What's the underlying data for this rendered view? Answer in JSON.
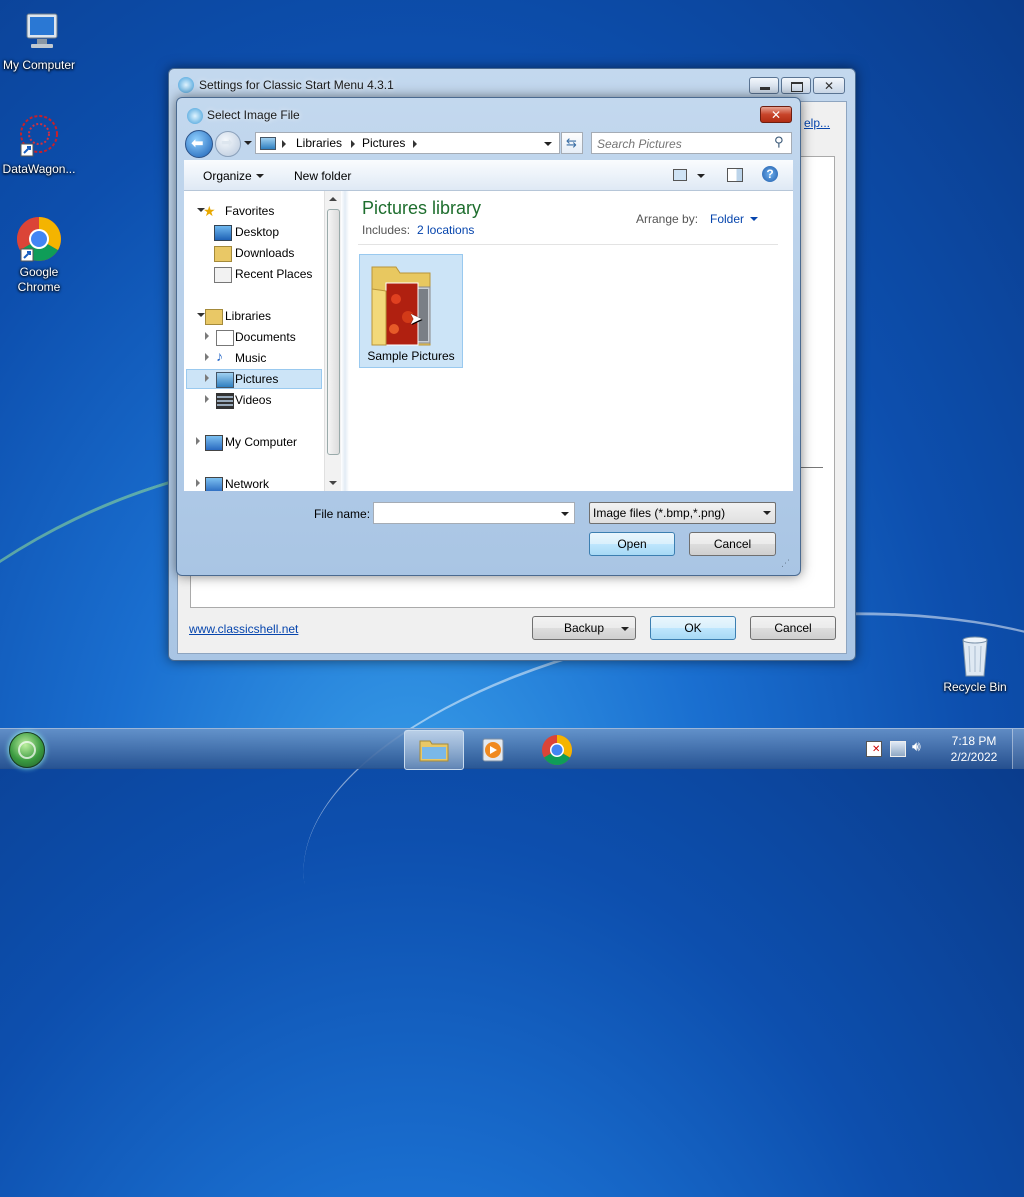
{
  "desktop": {
    "icons": [
      {
        "label": "My Computer"
      },
      {
        "label": "DataWagon..."
      },
      {
        "label_line1": "Google",
        "label_line2": "Chrome"
      },
      {
        "label": "Recycle Bin"
      }
    ]
  },
  "settings_window": {
    "title": "Settings for Classic Start Menu 4.3.1",
    "help_link": "elp...",
    "website_link": "www.classicshell.net",
    "backup_label": "Backup",
    "ok_label": "OK",
    "cancel_label": "Cancel"
  },
  "dialog": {
    "title": "Select Image File",
    "breadcrumb": [
      "Libraries",
      "Pictures"
    ],
    "search_placeholder": "Search Pictures",
    "toolbar": {
      "organize": "Organize",
      "new_folder": "New folder"
    },
    "nav": {
      "favorites": "Favorites",
      "favorites_items": [
        "Desktop",
        "Downloads",
        "Recent Places"
      ],
      "libraries": "Libraries",
      "libraries_items": [
        "Documents",
        "Music",
        "Pictures",
        "Videos"
      ],
      "computer": "My Computer",
      "network": "Network",
      "selected": "Pictures"
    },
    "library": {
      "title": "Pictures library",
      "includes_label": "Includes:",
      "includes_value": "2 locations",
      "arrange_label": "Arrange by:",
      "arrange_value": "Folder"
    },
    "items": [
      {
        "label": "Sample Pictures"
      }
    ],
    "file_name_label": "File name:",
    "file_name_value": "",
    "filter_value": "Image files (*.bmp,*.png)",
    "open_label": "Open",
    "cancel_label": "Cancel"
  },
  "taskbar": {
    "time": "7:18 PM",
    "date": "2/2/2022"
  },
  "colors": {
    "library_title": "#1e6e2e",
    "link": "#0645ad",
    "selection": "#cce4f7"
  }
}
